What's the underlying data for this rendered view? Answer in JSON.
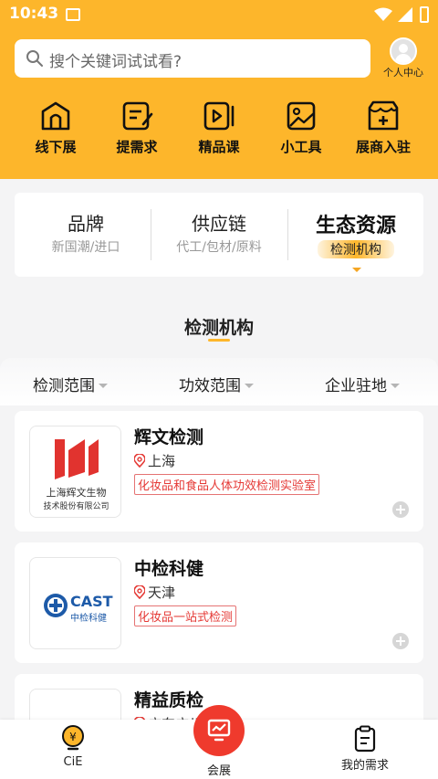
{
  "status_bar": {
    "time": "10:43"
  },
  "search": {
    "placeholder": "搜个关键词试试看?"
  },
  "profile": {
    "label": "个人中心"
  },
  "quick_actions": [
    {
      "label": "线下展",
      "icon": "exhibition-icon"
    },
    {
      "label": "提需求",
      "icon": "request-icon"
    },
    {
      "label": "精品课",
      "icon": "course-icon"
    },
    {
      "label": "小工具",
      "icon": "tools-icon"
    },
    {
      "label": "展商入驻",
      "icon": "store-join-icon"
    }
  ],
  "categories": [
    {
      "title": "品牌",
      "subtitle": "新国潮/进口"
    },
    {
      "title": "供应链",
      "subtitle": "代工/包材/原料"
    },
    {
      "title": "生态资源",
      "subtitle": "检测机构",
      "active": true
    }
  ],
  "section": {
    "title": "检测机构"
  },
  "filters": [
    {
      "label": "检测范围"
    },
    {
      "label": "功效范围"
    },
    {
      "label": "企业驻地"
    }
  ],
  "companies": [
    {
      "name": "辉文检测",
      "location": "上海",
      "tag": "化妆品和食品人体功效检测实验室",
      "logo_text_1": "上海辉文生物",
      "logo_text_2": "技术股份有限公司"
    },
    {
      "name": "中检科健",
      "location": "天津",
      "tag": "化妆品一站式检测",
      "logo_text_1": "CAST",
      "logo_text_2": "中检科健"
    },
    {
      "name": "精益质检",
      "location": "广东广州",
      "tag": ""
    }
  ],
  "bottom_nav": [
    {
      "label": "CiE",
      "icon": "bulb-icon"
    },
    {
      "label": "会展",
      "icon": "exhibition-screen-icon"
    },
    {
      "label": "我的需求",
      "icon": "clipboard-icon"
    }
  ],
  "colors": {
    "brand_yellow": "#fdb62b",
    "accent_red": "#ef3a2d",
    "tag_red": "#e53935"
  }
}
